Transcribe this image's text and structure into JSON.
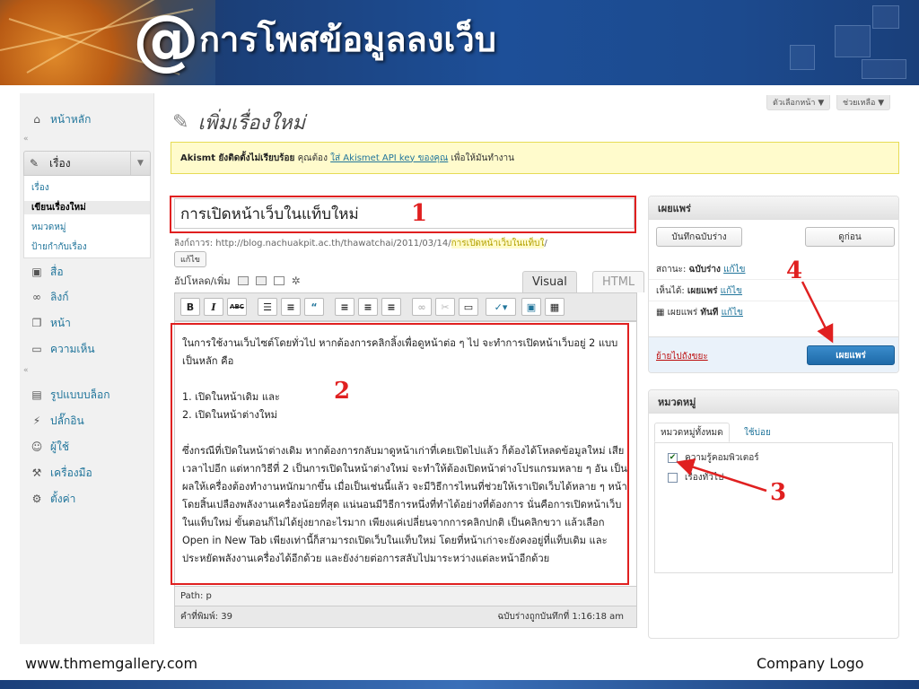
{
  "slide": {
    "at_symbol": "@",
    "title": "การโพสข้อมูลลงเว็บ",
    "footer_url": "www.thmemgallery.com",
    "footer_logo": "Company Logo"
  },
  "top_tabs": {
    "screen_options": "ตัวเลือกหน้า ▼",
    "help": "ช่วยเหลือ ▼"
  },
  "sidebar": {
    "dashboard": "หน้าหลัก",
    "separator": "«",
    "posts": "เรื่อง",
    "posts_submenu": [
      "เรื่อง",
      "เขียนเรื่องใหม่",
      "หมวดหมู่",
      "ป้ายกำกับเรื่อง"
    ],
    "media": "สื่อ",
    "links": "ลิงก์",
    "pages": "หน้า",
    "comments": "ความเห็น",
    "appearance": "รูปแบบบล็อก",
    "plugins": "ปลั๊กอิน",
    "users": "ผู้ใช้",
    "tools": "เครื่องมือ",
    "settings": "ตั้งค่า"
  },
  "main": {
    "heading": "เพิ่มเรื่องใหม่",
    "akismet_bold": "Akismt ยังติดตั้งไม่เรียบร้อย",
    "akismet_text1": " คุณต้อง ",
    "akismet_link": "ใส่ Akismet API key ของคุณ",
    "akismet_text2": " เพื่อให้มันทำงาน"
  },
  "editor": {
    "post_title": "การเปิดหน้าเว็บในแท็บใหม่",
    "permalink_label": "ลิงก์ถาวร: http://blog.nachuakpit.ac.th/thawatchai/2011/03/14/",
    "permalink_slug": "การเปิดหน้าเว็บในแท็บใ",
    "permalink_end": "/",
    "edit_slug_button": "แก้ไข",
    "upload_label": "อัปโหลด/เพิ่ม",
    "tab_visual": "Visual",
    "tab_html": "HTML",
    "content_para1": "ในการใช้งานเว็บไซต์โดยทั่วไป หากต้องการคลิกลิ้งเพื่อดูหน้าต่อ ๆ ไป จะทำการเปิดหน้าเว็บอยู่ 2 แบบเป็นหลัก คือ",
    "content_list1": "1. เปิดในหน้าเดิม และ",
    "content_list2": "2. เปิดในหน้าต่างใหม่",
    "content_para2": "ซึ่งกรณีที่เปิดในหน้าต่างเดิม หากต้องการกลับมาดูหน้าเก่าที่เคยเปิดไปแล้ว ก็ต้องได้โหลดข้อมูลใหม่ เสียเวลาไปอีก แต่หากวิธีที่ 2 เป็นการเปิดในหน้าต่างใหม่ จะทำให้ต้องเปิดหน้าต่างโปรแกรมหลาย ๆ อัน เป็นผลให้เครื่องต้องทำงานหนักมากขึ้น เมื่อเป็นเช่นนี้แล้ว จะมีวิธีการไหนที่ช่วยให้เราเปิดเว็บได้หลาย ๆ หน้า โดยสิ้นเปลืองพลังงานเครื่องน้อยที่สุด แน่นอนมีวิธีการหนึ่งที่ทำได้อย่างที่ต้องการ นั่นคือการเปิดหน้าเว็บในแท็บใหม่ ขั้นตอนก็ไม่ได้ยุ่งยากอะไรมาก เพียงแค่เปลี่ยนจากการคลิกปกติ เป็นคลิกขวา แล้วเลือก Open in New Tab เพียงเท่านี้ก็สามารถเปิดเว็บในแท็บใหม่ โดยที่หน้าเก่าจะยังคงอยู่ที่แท็บเดิม และประหยัดพลังงานเครื่องได้อีกด้วย และยังง่ายต่อการสลับไปมาระหว่างแต่ละหน้าอีกด้วย",
    "path": "Path: p",
    "word_count": "คำที่พิมพ์: 39",
    "draft_saved": "ฉบับร่างถูกบันทึกที่ 1:16:18 am"
  },
  "publish": {
    "header": "เผยแพร่",
    "save_draft": "บันทึกฉบับร่าง",
    "preview": "ดูก่อน",
    "status_label": "สถานะ: ",
    "status_value": "ฉบับร่าง",
    "visibility_label": "เห็นได้: ",
    "visibility_value": "เผยแพร่",
    "schedule_label": "เผยแพร่ ",
    "schedule_value": "ทันที",
    "edit_link": "แก้ไข",
    "trash": "ย้ายไปถังขยะ",
    "publish_button": "เผยแพร่"
  },
  "categories": {
    "header": "หมวดหมู่",
    "tab_all": "หมวดหมู่ทั้งหมด",
    "tab_popular": "ใช้บ่อย",
    "items": [
      {
        "label": "ความรู้คอมพิวเตอร์",
        "checked": true
      },
      {
        "label": "เรื่องทั่วไป",
        "checked": false
      }
    ]
  },
  "annotations": {
    "n1": "1",
    "n2": "2",
    "n3": "3",
    "n4": "4",
    "color": "#e02020"
  }
}
